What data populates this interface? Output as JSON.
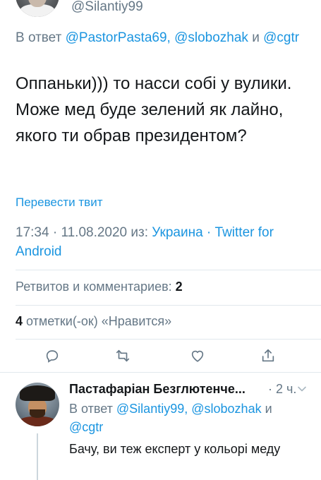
{
  "tweet": {
    "handle": "@Silantiy99",
    "reply_prefix": "В ответ",
    "reply_mentions": [
      "@PastorPasta69,",
      "@slobozhak",
      "@cgtr"
    ],
    "reply_and": "и",
    "text": "Оппаньки))) то насси собі у вулики. Може мед буде зелений як лайно, якого ти обрав президентом?",
    "translate_label": "Перевести твит",
    "time": "17:34",
    "date": "11.08.2020",
    "from_label": "из:",
    "location": "Украина",
    "source": "Twitter for Android",
    "separator": "·"
  },
  "stats": {
    "retweets_label": "Ретвитов и комментариев:",
    "retweets_count": "2",
    "likes_count": "4",
    "likes_label": "отметки(-ок) «Нравится»"
  },
  "actions": {
    "icons": [
      "reply-icon",
      "retweet-icon",
      "like-icon",
      "share-icon"
    ]
  },
  "reply": {
    "name": "Пастафаріан Безглютенче...",
    "time": "· 2 ч.",
    "reply_prefix": "В ответ",
    "reply_mentions": [
      "@Silantiy99,",
      "@slobozhak",
      "@cgtr"
    ],
    "reply_and": "и",
    "text": "Бачу, ви теж експерт у кольорі меду"
  },
  "colors": {
    "link": "#1b95e0",
    "secondary": "#657786",
    "text": "#14171a",
    "divider": "#e1e8ed"
  }
}
